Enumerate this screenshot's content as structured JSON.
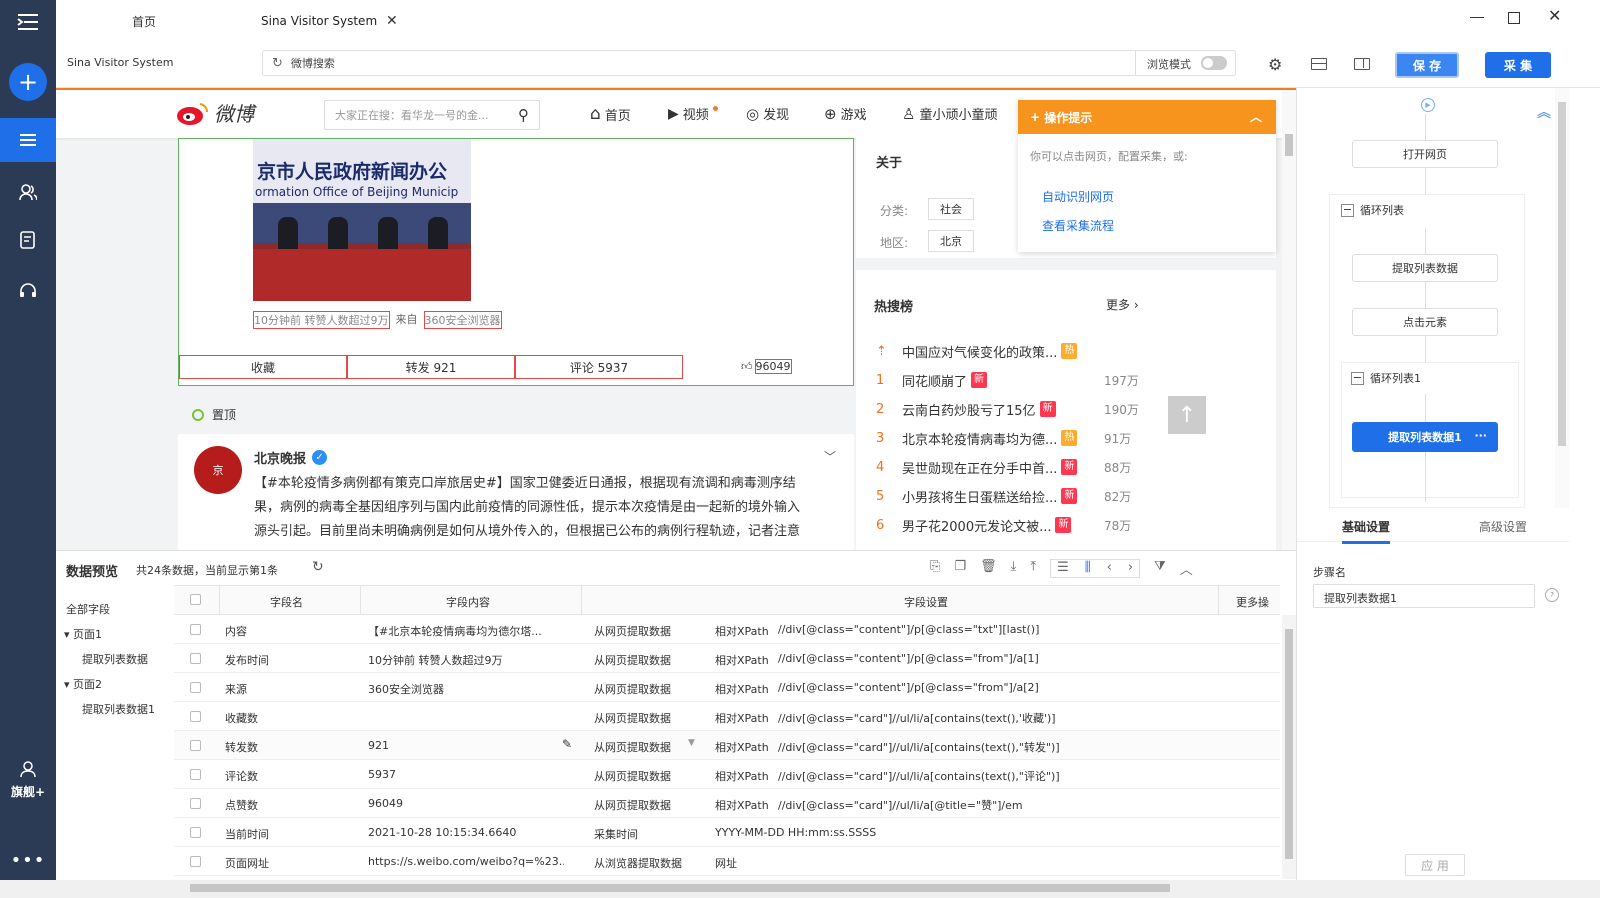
{
  "window": {
    "tab_home": "首页",
    "tab_active": "Sina Visitor System",
    "sub_title": "Sina Visitor System"
  },
  "address": {
    "placeholder_text": "微博搜索",
    "browse_mode_label": "浏览模式"
  },
  "toolbar": {
    "save_label": "保 存",
    "collect_label": "采 集"
  },
  "leftbar": {
    "flagship_label": "旗舰+"
  },
  "weibo": {
    "logo_text": "微博",
    "search_placeholder": "大家正在搜：看华龙一号的金...",
    "nav": [
      "首页",
      "视频",
      "发现",
      "游戏",
      "童小顽小童顽"
    ],
    "post_image_line1": "京市人民政府新闻办公",
    "post_image_line2": "ormation Office of Beijing Municip",
    "post_meta_time": "10分钟前 转赞人数超过9万",
    "post_meta_from": "来自",
    "post_meta_source": "360安全浏览器",
    "action_fav": "收藏",
    "action_repost": "转发 921",
    "action_comment": "评论 5937",
    "action_like": "96049",
    "pinned_label": "置顶",
    "author": "北京晚报",
    "post_text_line1": "【#本轮疫情多病例都有策克口岸旅居史#】国家卫健委近日通报，根据现有流调和病毒测序结",
    "post_text_line2": "果，病例的病毒全基因组序列与国内此前疫情的同源性低，提示本次疫情是由一起新的境外输入",
    "post_text_line3": "源头引起。目前里尚未明确病例是如何从境外传入的，但根据已公布的病例行程轨迹，记者注意",
    "about_title": "关于",
    "category_label": "分类:",
    "category_value": "社会",
    "region_label": "地区:",
    "region_value": "北京",
    "hot_title": "热搜榜",
    "hot_more": "更多",
    "hot_list": [
      {
        "rank": "",
        "title": "中国应对气候变化的政策...",
        "count": "",
        "badge": "热"
      },
      {
        "rank": "1",
        "title": "同花顺崩了",
        "count": "197万",
        "badge": "新"
      },
      {
        "rank": "2",
        "title": "云南白药炒股亏了15亿",
        "count": "190万",
        "badge": "新"
      },
      {
        "rank": "3",
        "title": "北京本轮疫情病毒均为德...",
        "count": "91万",
        "badge": "热"
      },
      {
        "rank": "4",
        "title": "吴世勋现在正在分手中首...",
        "count": "88万",
        "badge": "新"
      },
      {
        "rank": "5",
        "title": "小男孩将生日蛋糕送给捡...",
        "count": "82万",
        "badge": "新"
      },
      {
        "rank": "6",
        "title": "男子花2000元发论文被...",
        "count": "78万",
        "badge": "新"
      }
    ],
    "tips_title": "操作提示",
    "tips_text": "你可以点击网页，配置采集，或:",
    "tips_link1": "自动识别网页",
    "tips_link2": "查看采集流程"
  },
  "data_preview": {
    "title": "数据预览",
    "summary": "共24条数据，当前显示第1条",
    "tree": {
      "all": "全部字段",
      "page1": "页面1",
      "page1_child": "提取列表数据",
      "page2": "页面2",
      "page2_child": "提取列表数据1"
    },
    "headers": {
      "name": "字段名",
      "content": "字段内容",
      "setting": "字段设置",
      "more": "更多操"
    },
    "rows": [
      {
        "name": "内容",
        "content": "【#北京本轮疫情病毒均为德尔塔...",
        "source": "从网页提取数据",
        "mode": "相对XPath",
        "xpath": "//div[@class=\"content\"]/p[@class=\"txt\"][last()]"
      },
      {
        "name": "发布时间",
        "content": "10分钟前 转赞人数超过9万",
        "source": "从网页提取数据",
        "mode": "相对XPath",
        "xpath": "//div[@class=\"content\"]/p[@class=\"from\"]/a[1]"
      },
      {
        "name": "来源",
        "content": "360安全浏览器",
        "source": "从网页提取数据",
        "mode": "相对XPath",
        "xpath": "//div[@class=\"content\"]/p[@class=\"from\"]/a[2]"
      },
      {
        "name": "收藏数",
        "content": "",
        "source": "从网页提取数据",
        "mode": "相对XPath",
        "xpath": "//div[@class=\"card\"]//ul/li/a[contains(text(),'收藏')]"
      },
      {
        "name": "转发数",
        "content": "921",
        "source": "从网页提取数据",
        "mode": "相对XPath",
        "xpath": "//div[@class=\"card\"]//ul/li/a[contains(text(),\"转发\")]"
      },
      {
        "name": "评论数",
        "content": "5937",
        "source": "从网页提取数据",
        "mode": "相对XPath",
        "xpath": "//div[@class=\"card\"]//ul/li/a[contains(text(),\"评论\")]"
      },
      {
        "name": "点赞数",
        "content": "96049",
        "source": "从网页提取数据",
        "mode": "相对XPath",
        "xpath": "//div[@class=\"card\"]//ul/li/a[@title=\"赞\"]/em"
      },
      {
        "name": "当前时间",
        "content": "2021-10-28 10:15:34.6640",
        "source": "采集时间",
        "mode": "YYYY-MM-DD HH:mm:ss.SSSS",
        "xpath": ""
      },
      {
        "name": "页面网址",
        "content": "https://s.weibo.com/weibo?q=%23...",
        "source": "从浏览器提取数据",
        "mode": "网址",
        "xpath": ""
      }
    ]
  },
  "flow": {
    "open_page": "打开网页",
    "loop_list": "循环列表",
    "extract_list": "提取列表数据",
    "click_element": "点击元素",
    "loop_list1": "循环列表1",
    "extract_list1": "提取列表数据1",
    "more_dots": "···"
  },
  "settings": {
    "tab_basic": "基础设置",
    "tab_advanced": "高级设置",
    "step_name_label": "步骤名",
    "step_name_value": "提取列表数据1",
    "apply_label": "应 用"
  }
}
